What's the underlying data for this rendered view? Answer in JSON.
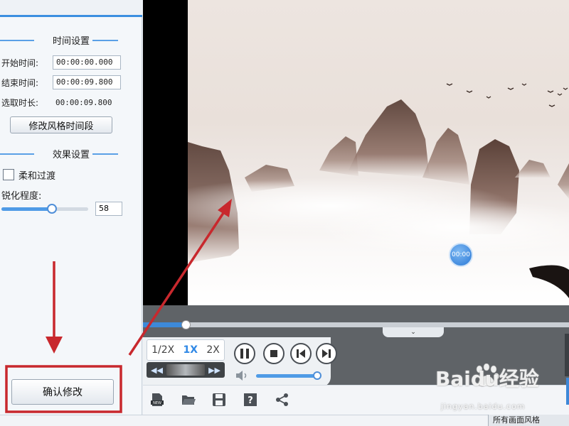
{
  "time_settings": {
    "title": "时间设置",
    "start_label": "开始时间:",
    "start_value": "00:00:00.000",
    "end_label": "结束时间:",
    "end_value": "00:00:09.800",
    "duration_label": "选取时长:",
    "duration_value": "00:00:09.800",
    "modify_button": "修改风格时间段"
  },
  "effect_settings": {
    "title": "效果设置",
    "soft_transition_label": "柔和过渡",
    "soft_transition_checked": false,
    "sharpen_label": "锐化程度:",
    "sharpen_value": "58",
    "sharpen_fraction": 0.58
  },
  "confirm_button": "确认修改",
  "player": {
    "timer_badge": "00:00",
    "progress_fraction": 0.1,
    "speed_options": [
      "1/2X",
      "1X",
      "2X"
    ],
    "speed_selected": "1X",
    "volume_fraction": 0.93,
    "tab_chevron": "⌄"
  },
  "toolbar": {
    "icons": [
      "new-file-icon",
      "open-folder-icon",
      "save-icon",
      "help-icon",
      "share-icon"
    ]
  },
  "bottom_right_text": "所有画面风格",
  "watermark": {
    "brand": "Baidu经验",
    "url": "jingyan.baidu.com"
  },
  "colors": {
    "accent": "#3b8fe0",
    "annotation_red": "#c8282d"
  }
}
